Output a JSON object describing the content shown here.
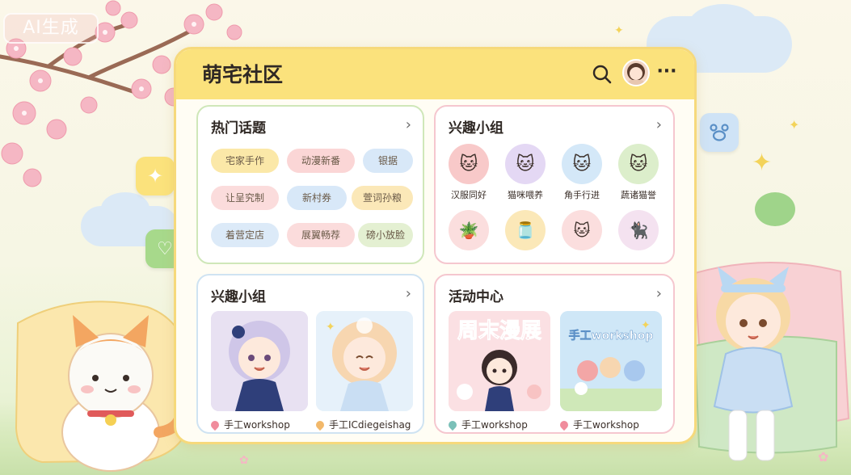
{
  "watermark": "AI生成",
  "app": {
    "title": "萌宅社区",
    "header_icons": [
      "search-icon",
      "avatar",
      "more-icon"
    ]
  },
  "hot_topics": {
    "title": "热门话题",
    "tags": [
      {
        "label": "宅家手作",
        "color": "#fbe8a8"
      },
      {
        "label": "动漫新番",
        "color": "#fbd6d6"
      },
      {
        "label": "银据",
        "color": "#d8e8f8"
      },
      {
        "label": "让呈究制",
        "color": "#fbdcdc"
      },
      {
        "label": "新村券",
        "color": "#d8e8f8"
      },
      {
        "label": "萱词孙粮",
        "color": "#fbe8b8"
      },
      {
        "label": "着营定店",
        "color": "#dceaf8"
      },
      {
        "label": "展翼畅荐",
        "color": "#fbdcdc"
      },
      {
        "label": "磅小放脸",
        "color": "#e4f0d2"
      }
    ]
  },
  "interest_groups_icons": {
    "title": "兴趣小组",
    "items": [
      {
        "label": "汉服同好",
        "icon": "cat-icon",
        "color": "#f8c9c9"
      },
      {
        "label": "猫咪喂养",
        "icon": "cat-icon",
        "color": "#e4d8f4"
      },
      {
        "label": "角手行进",
        "icon": "cat-icon",
        "color": "#d4e8f8"
      },
      {
        "label": "蔬诸猫誉",
        "icon": "cat-icon",
        "color": "#dceecb"
      },
      {
        "label": "",
        "icon": "plant-icon",
        "color": "#fbdede"
      },
      {
        "label": "",
        "icon": "jar-icon",
        "color": "#fbe8b8"
      },
      {
        "label": "",
        "icon": "cat-icon",
        "color": "#fbdede"
      },
      {
        "label": "",
        "icon": "black-cat-icon",
        "color": "#f4e2f0"
      }
    ]
  },
  "interest_groups_gallery": {
    "title": "兴趣小组",
    "items": [
      {
        "label": "手工workshop",
        "pin_color": "#f08c9c"
      },
      {
        "label": "手工ICdiegeishag",
        "pin_color": "#f2b86a"
      }
    ]
  },
  "events": {
    "title": "活动中心",
    "items": [
      {
        "banner": "周末漫展",
        "label": "手工workshop",
        "pin_color": "#7ac0b8"
      },
      {
        "banner": "手工workshop",
        "label": "手工workshop",
        "pin_color": "#f08c9c"
      }
    ]
  },
  "side_buttons": [
    "sparkle-icon",
    "heart-icon",
    "paw-icon"
  ]
}
